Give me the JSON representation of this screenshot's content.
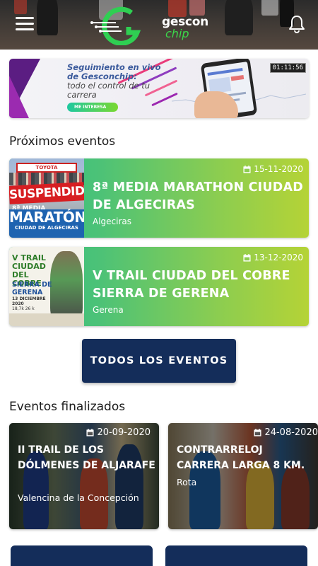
{
  "header": {
    "logo_line1": "gescon",
    "logo_line2": "chip"
  },
  "banner": {
    "title": "Seguimiento en vivo de Gesconchip:",
    "subtitle": "todo el control de tu carrera",
    "cta": "ME INTERESA",
    "timer": "01:11:56"
  },
  "upcoming": {
    "title": "Próximos eventos",
    "events": [
      {
        "date": "15-11-2020",
        "name": "8ª MEDIA MARATHON CIUDAD DE ALGECIRAS",
        "location": "Algeciras",
        "thumb": {
          "arch_text": "TOYOTA",
          "stamp": "SUSPENDIDA",
          "edition": "8ª MEDIA",
          "big": "MARATÓN",
          "small": "CIUDAD DE ALGECIRAS"
        }
      },
      {
        "date": "13-12-2020",
        "name": "V TRAIL CIUDAD DEL COBRE SIERRA DE GERENA",
        "location": "Gerena",
        "thumb": {
          "title": "V TRAIL CIUDAD DEL COBRE",
          "sierra": "SIERRA DE GERENA",
          "date": "13 DICIEMBRE 2020",
          "km": "18,7k 26 k"
        }
      }
    ],
    "all_events_button": "TODOS LOS EVENTOS"
  },
  "finished": {
    "title": "Eventos finalizados",
    "events": [
      {
        "date": "20-09-2020",
        "name": "II TRAIL DE LOS DÓLMENES DE ALJARAFE",
        "location": "Valencina de la Concepción"
      },
      {
        "date": "24-08-2020",
        "name": "CONTRARRELOJ CARRERA LARGA 8 KM.",
        "location": "Rota"
      }
    ]
  },
  "colors": {
    "primary_navy": "#142d5a",
    "gradient_start": "#2ebc87",
    "gradient_end": "#b5d336",
    "logo_green": "#3bd84a"
  }
}
